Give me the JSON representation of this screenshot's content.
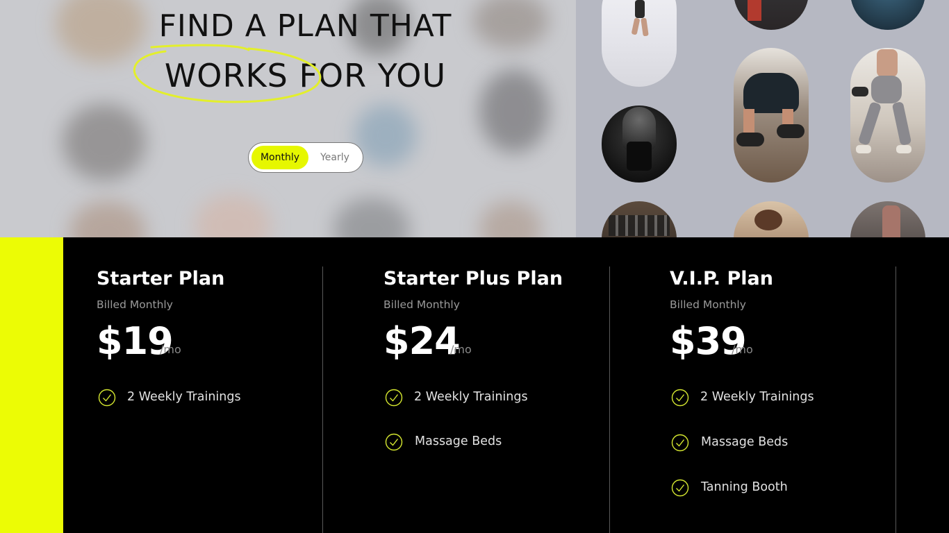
{
  "hero": {
    "title_line1": "FIND A PLAN THAT",
    "title_line2": "WORKS FOR YOU",
    "billing_toggle": {
      "options": [
        "Monthly",
        "Yearly"
      ],
      "selected": "Monthly"
    }
  },
  "colors": {
    "accent": "#ECFC05",
    "background_dark": "#000000",
    "check_stroke": "#D6E830"
  },
  "plans": [
    {
      "name": "Starter Plan",
      "billing": "Billed Monthly",
      "price": "$19",
      "period": "/mo",
      "features": [
        "2 Weekly Trainings"
      ]
    },
    {
      "name": "Starter Plus Plan",
      "billing": "Billed Monthly",
      "price": "$24",
      "period": "/mo",
      "features": [
        "2 Weekly Trainings",
        "Massage Beds"
      ]
    },
    {
      "name": "V.I.P. Plan",
      "billing": "Billed Monthly",
      "price": "$39",
      "period": "/mo",
      "features": [
        "2 Weekly Trainings",
        "Massage Beds",
        "Tanning Booth"
      ]
    }
  ],
  "icons": {
    "feature_check": "check-circle-icon"
  }
}
